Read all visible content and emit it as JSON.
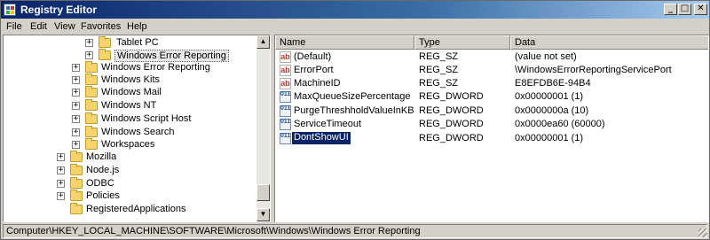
{
  "window": {
    "title": "Registry Editor"
  },
  "titlebar_buttons": {
    "minimize": "_",
    "maximize": "□",
    "close": "✕"
  },
  "menu": [
    "File",
    "Edit",
    "View",
    "Favorites",
    "Help"
  ],
  "tree": [
    {
      "label": "Tablet PC",
      "expander": "+"
    },
    {
      "label": "Windows Error Reporting",
      "expander": "+",
      "selected": true
    },
    {
      "label": "Windows Error Reporting",
      "expander": "+"
    },
    {
      "label": "Windows Kits",
      "expander": "+"
    },
    {
      "label": "Windows Mail",
      "expander": "+"
    },
    {
      "label": "Windows NT",
      "expander": "+"
    },
    {
      "label": "Windows Script Host",
      "expander": "+"
    },
    {
      "label": "Windows Search",
      "expander": "+"
    },
    {
      "label": "Workspaces",
      "expander": "+"
    },
    {
      "label": "Mozilla",
      "expander": "+"
    },
    {
      "label": "Node.js",
      "expander": "+"
    },
    {
      "label": "ODBC",
      "expander": "+"
    },
    {
      "label": "Policies",
      "expander": "+"
    },
    {
      "label": "RegisteredApplications",
      "expander": ""
    }
  ],
  "columns": {
    "name": "Name",
    "type": "Type",
    "data": "Data"
  },
  "values": [
    {
      "name": "(Default)",
      "type": "REG_SZ",
      "data": "(value not set)",
      "icon": "string-value-icon"
    },
    {
      "name": "ErrorPort",
      "type": "REG_SZ",
      "data": "\\WindowsErrorReportingServicePort",
      "icon": "string-value-icon"
    },
    {
      "name": "MachineID",
      "type": "REG_SZ",
      "data": "E8EFDB6E-94B4",
      "icon": "string-value-icon"
    },
    {
      "name": "MaxQueueSizePercentage",
      "type": "REG_DWORD",
      "data": "0x00000001 (1)",
      "icon": "dword-value-icon"
    },
    {
      "name": "PurgeThreshholdValueInKB",
      "type": "REG_DWORD",
      "data": "0x0000000a (10)",
      "icon": "dword-value-icon"
    },
    {
      "name": "ServiceTimeout",
      "type": "REG_DWORD",
      "data": "0x0000ea60 (60000)",
      "icon": "dword-value-icon"
    },
    {
      "name": "DontShowUI",
      "type": "REG_DWORD",
      "data": "0x00000001 (1)",
      "icon": "dword-value-icon",
      "selected": true
    }
  ],
  "icon_glyphs": {
    "sz": "ab",
    "dword": "011"
  },
  "status": {
    "path": "Computer\\HKEY_LOCAL_MACHINE\\SOFTWARE\\Microsoft\\Windows\\Windows Error Reporting"
  }
}
